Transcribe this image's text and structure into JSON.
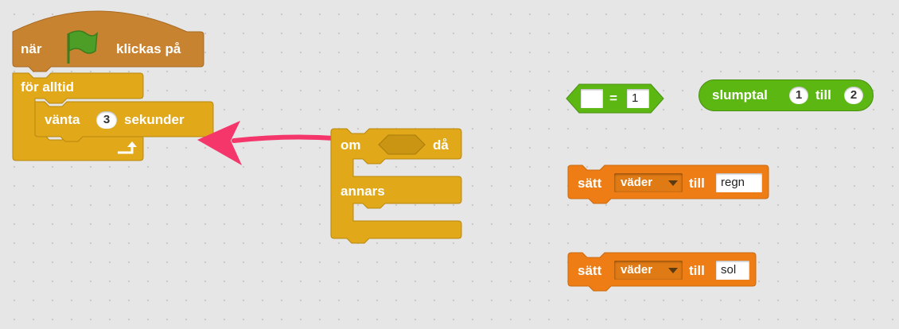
{
  "script_main": {
    "hat_when": "när",
    "hat_clicked": "klickas på",
    "forever": "för alltid",
    "wait": "vänta",
    "wait_value": "3",
    "wait_seconds": "sekunder"
  },
  "if_else_block": {
    "if": "om",
    "then": "då",
    "else": "annars"
  },
  "equals_block": {
    "operator": "=",
    "right_value": "1"
  },
  "random_block": {
    "label": "slumptal",
    "from": "1",
    "to_label": "till",
    "to": "2"
  },
  "set_block_1": {
    "set": "sätt",
    "variable": "väder",
    "to_label": "till",
    "value": "regn"
  },
  "set_block_2": {
    "set": "sätt",
    "variable": "väder",
    "to_label": "till",
    "value": "sol"
  },
  "colors": {
    "events": "#c88330",
    "control": "#e1a91a",
    "operators": "#5cb712",
    "data": "#ee7d16",
    "arrow": "#f5366b",
    "flag": "#4c9e26"
  },
  "icons": [
    "green-flag-icon",
    "loop-arrow-icon",
    "pointer-arrow-icon",
    "dropdown-arrow-icon"
  ]
}
